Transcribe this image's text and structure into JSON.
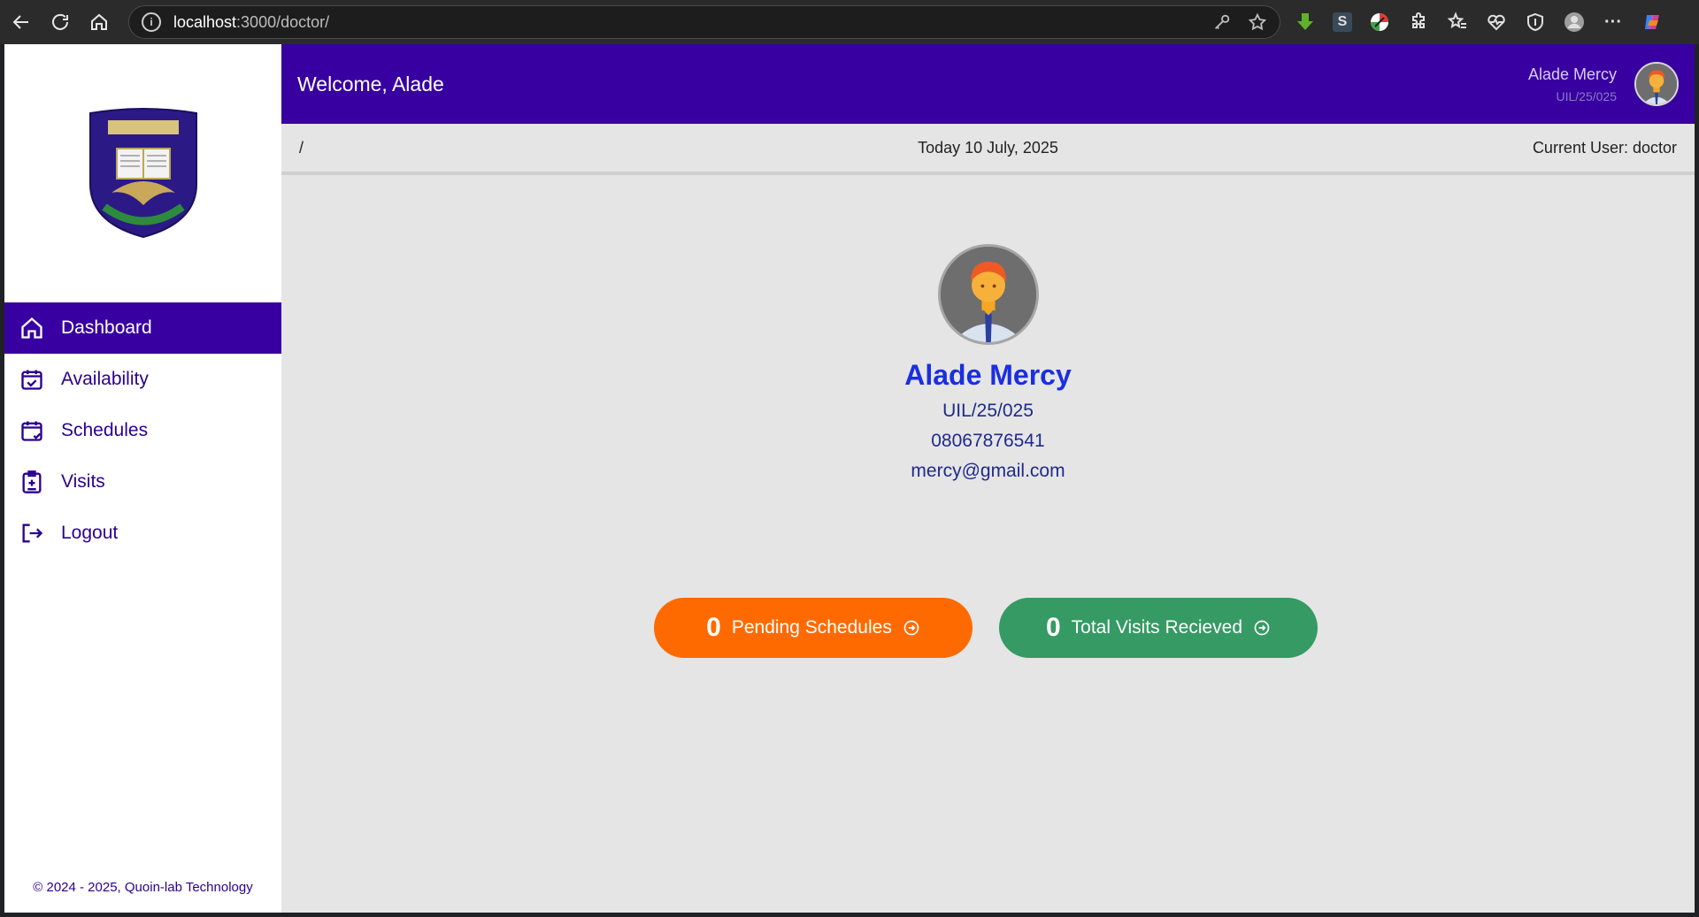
{
  "browser": {
    "url_host": "localhost",
    "url_path": ":3000/doctor/"
  },
  "sidebar": {
    "items": [
      {
        "label": "Dashboard",
        "icon": "home-icon",
        "active": true
      },
      {
        "label": "Availability",
        "icon": "calendar-check-icon",
        "active": false
      },
      {
        "label": "Schedules",
        "icon": "calendar-icon",
        "active": false
      },
      {
        "label": "Visits",
        "icon": "clipboard-medical-icon",
        "active": false
      },
      {
        "label": "Logout",
        "icon": "logout-icon",
        "active": false
      }
    ],
    "copyright": "© 2024 - 2025, Quoin-lab Technology"
  },
  "header": {
    "welcome": "Welcome, Alade",
    "user_name": "Alade Mercy",
    "user_id": "UIL/25/025"
  },
  "crumbbar": {
    "breadcrumb": "/",
    "date": "Today 10 July, 2025",
    "current_user": "Current User: doctor"
  },
  "profile": {
    "name": "Alade Mercy",
    "id": "UIL/25/025",
    "phone": "08067876541",
    "email": "mercy@gmail.com"
  },
  "stats": {
    "pending_count": "0",
    "pending_label": "Pending Schedules",
    "visits_count": "0",
    "visits_label": "Total Visits Recieved"
  },
  "colors": {
    "brand": "#3800a0",
    "pending": "#ff6a00",
    "visits": "#359a64",
    "name": "#1b2ee0"
  }
}
